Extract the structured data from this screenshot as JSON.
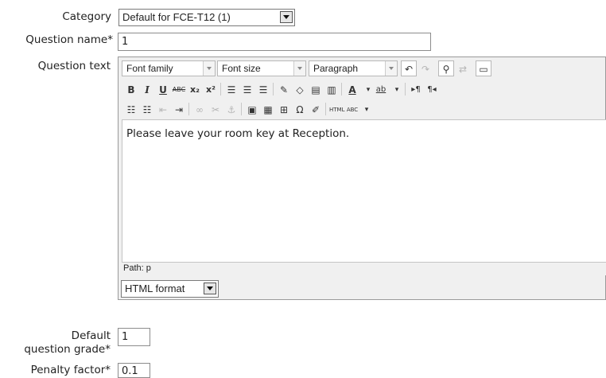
{
  "category": {
    "label": "Category",
    "selected": "Default for FCE-T12 (1)"
  },
  "question_name": {
    "label": "Question name*",
    "value": "1"
  },
  "question_text": {
    "label": "Question text",
    "toolbar": {
      "font_family": "Font family",
      "font_size": "Font size",
      "paragraph": "Paragraph",
      "row1_icons": [
        "undo-icon",
        "redo-icon",
        "find-icon",
        "replace-icon",
        "fullscreen-icon"
      ],
      "row2_icons": [
        "bold-icon",
        "italic-icon",
        "underline-icon",
        "strikethrough-icon",
        "subscript-icon",
        "superscript-icon",
        "align-left-icon",
        "align-center-icon",
        "align-right-icon",
        "cleanup-icon",
        "remove-format-icon",
        "paste-text-icon",
        "paste-word-icon",
        "text-color-icon",
        "highlight-color-icon",
        "ltr-icon",
        "rtl-icon"
      ],
      "row3_icons": [
        "bullet-list-icon",
        "numbered-list-icon",
        "outdent-icon",
        "indent-icon",
        "link-icon",
        "unlink-icon",
        "anchor-icon",
        "image-icon",
        "media-icon",
        "nonbreaking-icon",
        "special-char-icon",
        "edit-html-icon",
        "html-icon",
        "spellcheck-icon"
      ],
      "bold": "B",
      "italic": "I",
      "underline": "U",
      "strike": "ABC",
      "subscript": "x₂",
      "superscript": "x²",
      "html_btn": "HTML",
      "abc_spell": "ABC"
    },
    "content": "Please leave your room key at Reception.",
    "path": "Path: p",
    "format": "HTML format"
  },
  "default_grade": {
    "label_line1": "Default",
    "label_line2": "question grade*",
    "value": "1"
  },
  "penalty": {
    "label": "Penalty factor*",
    "value": "0.1"
  }
}
